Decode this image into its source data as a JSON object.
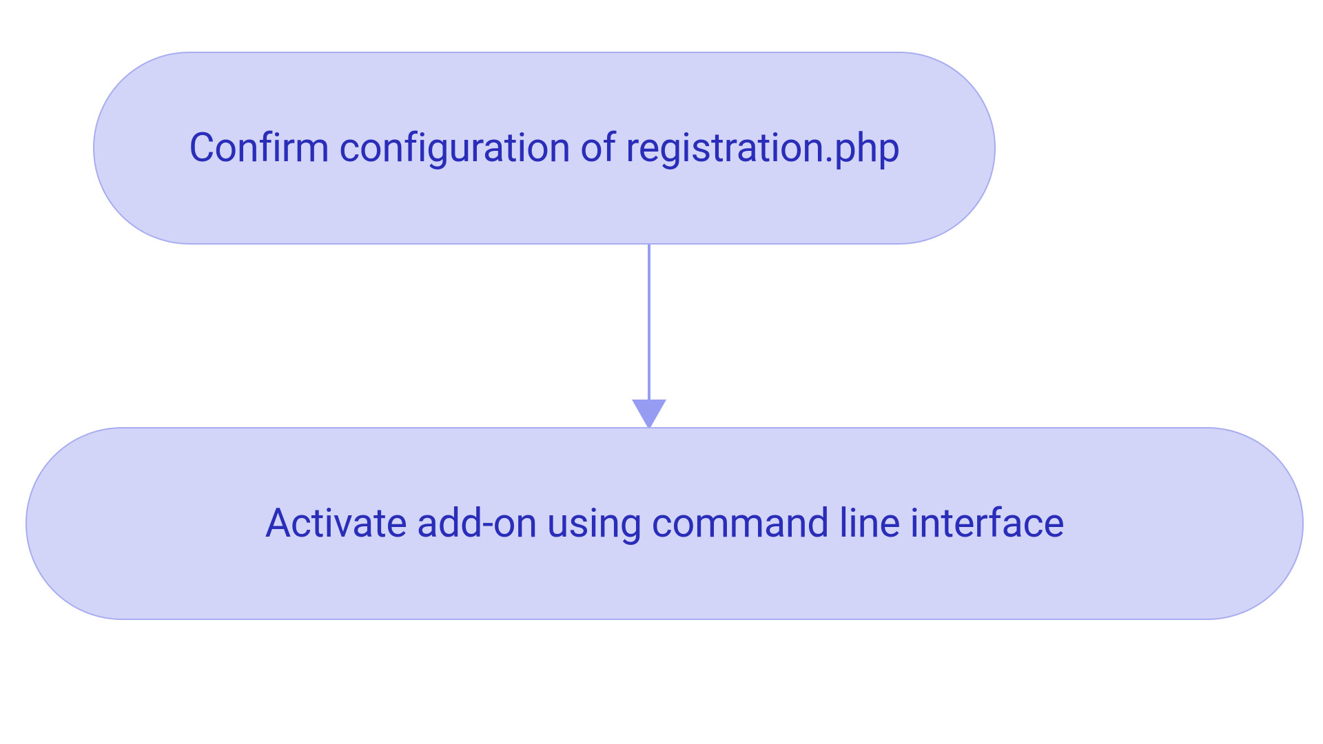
{
  "nodes": {
    "step1": "Confirm configuration of registration.php",
    "step2": "Activate add-on using command line interface"
  }
}
